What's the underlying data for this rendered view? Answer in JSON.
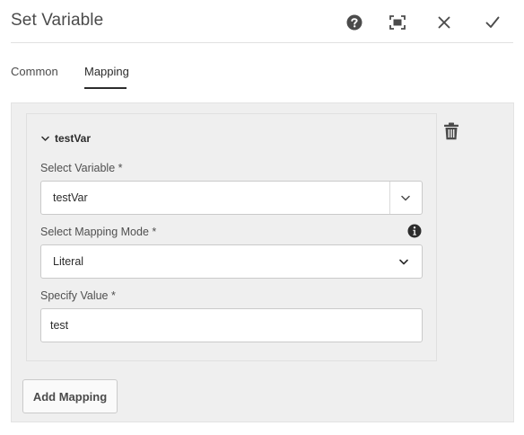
{
  "dialog": {
    "title": "Set Variable",
    "icons": {
      "help": "help-icon",
      "fullscreen": "fullscreen-icon",
      "close": "close-icon",
      "done": "checkmark-icon"
    }
  },
  "tabs": [
    {
      "label": "Common",
      "selected": false
    },
    {
      "label": "Mapping",
      "selected": true
    }
  ],
  "mapping": {
    "name": "testVar",
    "expanded": true,
    "fields": {
      "variable": {
        "label": "Select Variable *",
        "value": "testVar"
      },
      "mode": {
        "label": "Select Mapping Mode *",
        "value": "Literal"
      },
      "value": {
        "label": "Specify Value *",
        "value": "test"
      }
    }
  },
  "add_mapping_label": "Add Mapping",
  "colors": {
    "panel_background": "#efefef",
    "text": "#2c2c2c",
    "border": "#cacaca"
  }
}
